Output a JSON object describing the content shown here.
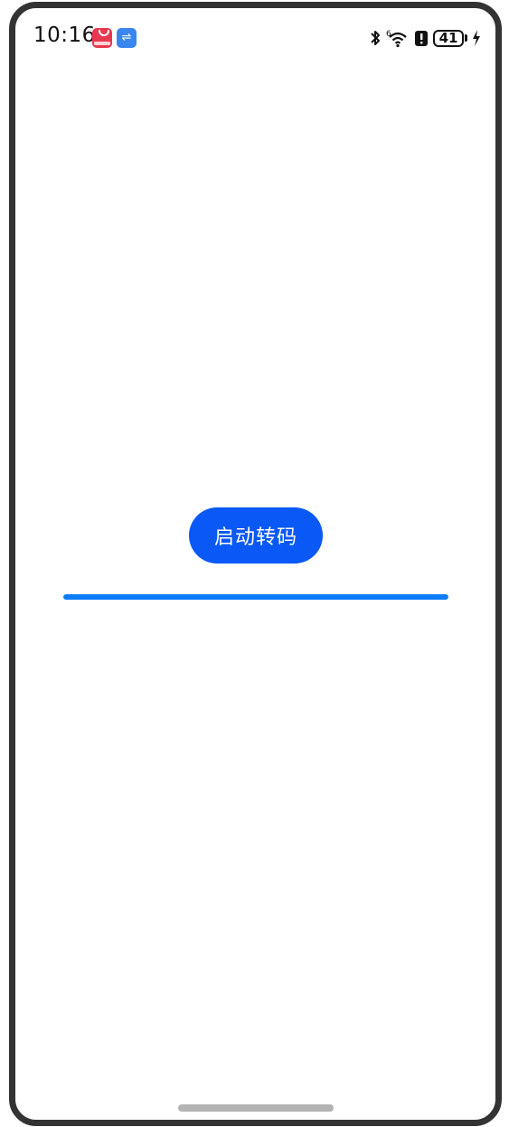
{
  "status_bar": {
    "time": "10:16",
    "battery_level": "41",
    "icons": [
      "app-gallery-icon",
      "usb-icon",
      "bluetooth-icon",
      "wifi-6-icon",
      "notification-alert-icon",
      "battery-icon",
      "charging-icon"
    ]
  },
  "main": {
    "start_button_label": "启动转码",
    "progress_fraction": 1.0,
    "progress_color": "#0a7cf8",
    "button_color": "#0a59f7"
  }
}
